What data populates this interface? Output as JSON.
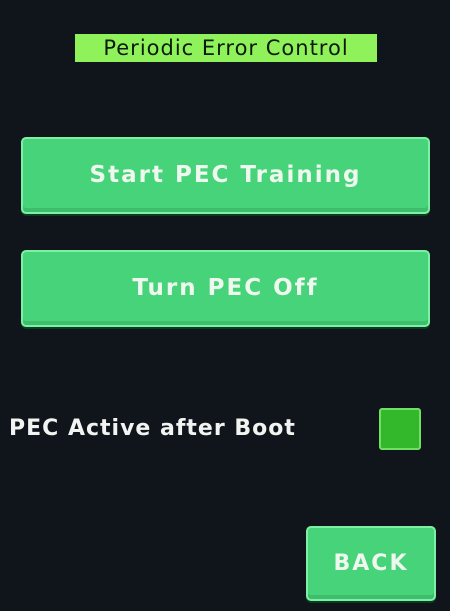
{
  "screen": {
    "title": "Periodic Error Control"
  },
  "buttons": {
    "start_training": "Start PEC Training",
    "turn_off": "Turn PEC Off",
    "back": "BACK"
  },
  "pec_active_option": {
    "label": "PEC Active after Boot",
    "checked": true
  },
  "colors": {
    "background": "#0f151b",
    "title_highlight": "#8ff25a",
    "button_green": "#46d37a",
    "checkbox_green": "#33b82c"
  }
}
